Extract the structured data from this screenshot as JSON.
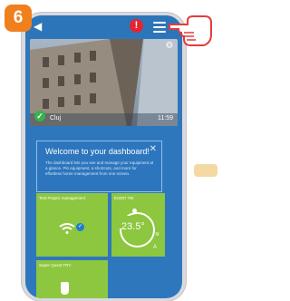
{
  "step_badge": "6",
  "topbar": {
    "back_icon": "back-arrow-icon",
    "notification_icon": "alert-icon",
    "notification_symbol": "!",
    "menu_icon": "hamburger-menu-icon"
  },
  "photo_card": {
    "location": "Cluj",
    "time": "11:59"
  },
  "welcome": {
    "title": "Welcome to your dashboard!",
    "text": "The dashboard lets you see and manage your equipment at a glance. Pin equipment, a shortcuts, and more for effortless home management from one screen."
  },
  "tiles": [
    {
      "label": "Test Project management"
    },
    {
      "label": "ES007 TM",
      "temperature": "23.5°"
    },
    {
      "label": "Super Quest TRV"
    }
  ],
  "colors": {
    "screen_blue": "#2f77bc",
    "tile_green": "#8dc63f",
    "alert_red": "#e2262f",
    "badge_orange": "#f07f1d"
  }
}
